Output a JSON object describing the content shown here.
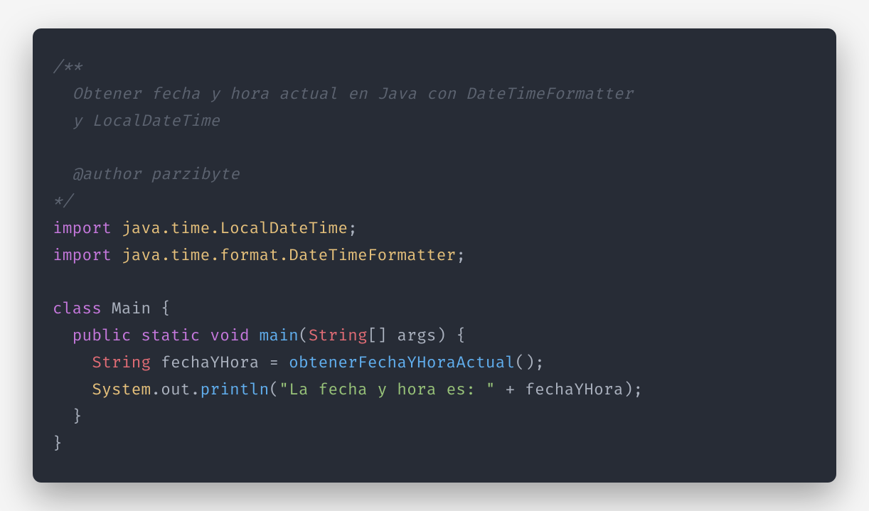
{
  "code": {
    "comment_open": "/**",
    "comment_line1_indent": "  ",
    "comment_line1": "Obtener fecha y hora actual en Java con DateTimeFormatter",
    "comment_line2_indent": "  ",
    "comment_line2": "y LocalDateTime",
    "comment_blank_indent": "",
    "comment_author_indent": "  ",
    "comment_author_tag": "@author",
    "comment_author_name": " parzibyte",
    "comment_close": "*/",
    "import_kw": "import",
    "import1_pkg": " java.time.LocalDateTime",
    "import2_pkg": " java.time.format.DateTimeFormatter",
    "semicolon": ";",
    "class_kw": "class",
    "class_name": " Main ",
    "brace_open": "{",
    "brace_close": "}",
    "indent2": "  ",
    "indent4": "    ",
    "public_kw": "public",
    "static_kw": " static",
    "void_kw": " void",
    "main_name": " main",
    "paren_open": "(",
    "paren_close": ")",
    "string_type": "String",
    "brackets": "[]",
    "args_name": " args",
    "space_brace": " {",
    "space": " ",
    "var_name": " fechaYHora ",
    "equals": "=",
    "call_func": " obtenerFechaYHoraActual",
    "empty_parens": "()",
    "system": "System",
    "dot": ".",
    "out": "out",
    "println": "println",
    "string_literal": "\"La fecha y hora es: \"",
    "plus": " + ",
    "var_ref": "fechaYHora"
  }
}
